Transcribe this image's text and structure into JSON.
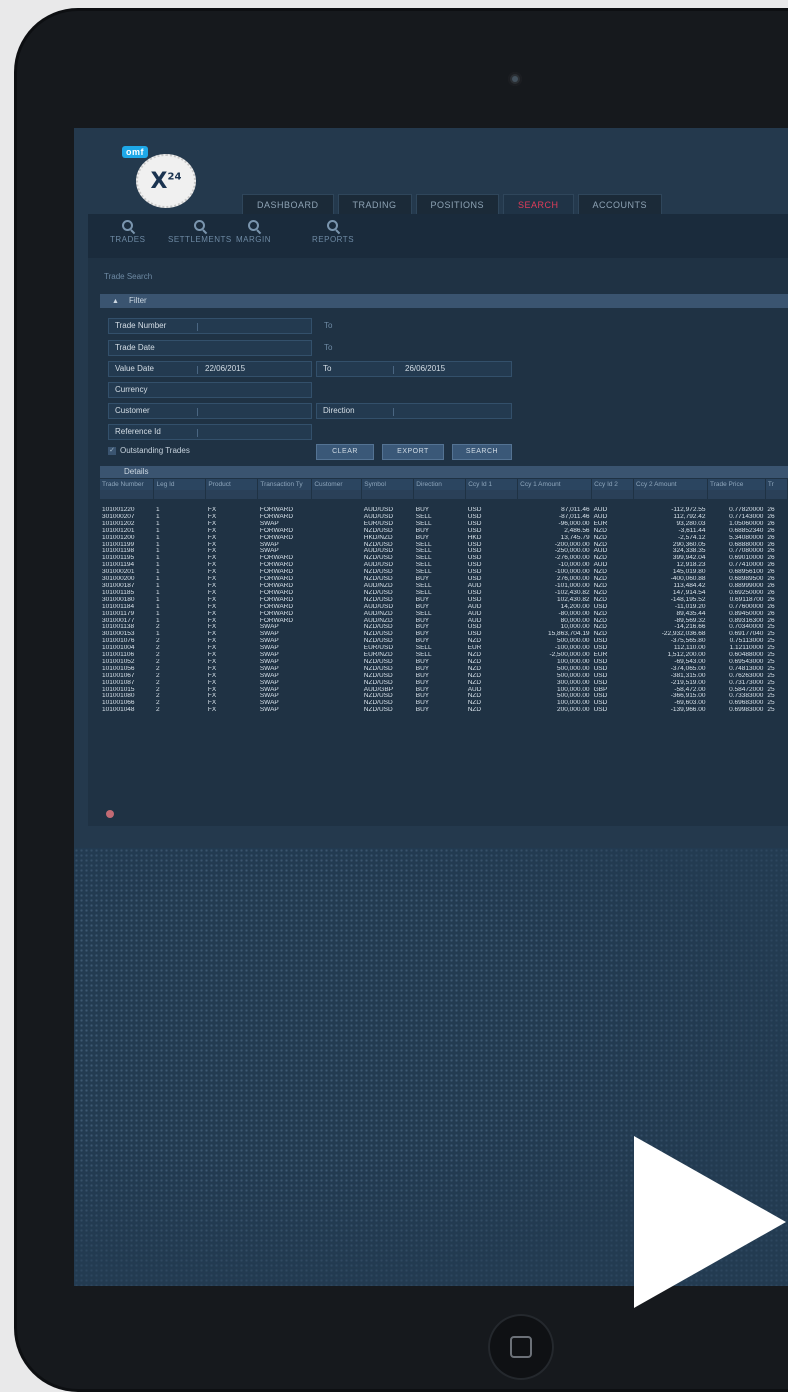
{
  "logo": {
    "tag": "omf",
    "mark": "X",
    "mark_sup": "24"
  },
  "tabs": [
    "DASHBOARD",
    "TRADING",
    "POSITIONS",
    "SEARCH",
    "ACCOUNTS"
  ],
  "active_tab": "SEARCH",
  "subnav": [
    "TRADES",
    "SETTLEMENTS",
    "MARGIN",
    "REPORTS"
  ],
  "section_title": "Trade Search",
  "filter": {
    "label": "Filter",
    "trade_number": "Trade Number",
    "trade_date": "Trade Date",
    "value_date": "Value Date",
    "value_date_from": "22/06/2015",
    "to": "To",
    "value_date_to": "26/06/2015",
    "currency": "Currency",
    "customer": "Customer",
    "direction": "Direction",
    "reference_id": "Reference Id",
    "outstanding": "Outstanding Trades",
    "buttons": {
      "clear": "CLEAR",
      "export": "EXPORT",
      "search": "SEARCH"
    }
  },
  "details": {
    "label": "Details",
    "columns": [
      "Trade Number",
      "Leg Id",
      "Product",
      "Transaction Ty",
      "Customer",
      "Symbol",
      "Direction",
      "Ccy Id 1",
      "Ccy 1 Amount",
      "Ccy Id 2",
      "Ccy 2 Amount",
      "Trade Price",
      "Tr"
    ],
    "rows": [
      [
        "101001220",
        "1",
        "FX",
        "FORWARD",
        "",
        "AUD/USD",
        "BUY",
        "USD",
        "87,011.46",
        "AUD",
        "-112,972.55",
        "0.77820000",
        "26"
      ],
      [
        "301000207",
        "1",
        "FX",
        "FORWARD",
        "",
        "AUD/USD",
        "SELL",
        "USD",
        "-87,011.46",
        "AUD",
        "112,792.42",
        "0.77143000",
        "26"
      ],
      [
        "101001202",
        "1",
        "FX",
        "SWAP",
        "",
        "EUR/USD",
        "SELL",
        "USD",
        "-96,000.00",
        "EUR",
        "93,280.03",
        "1.05060000",
        "26"
      ],
      [
        "101001201",
        "1",
        "FX",
        "FORWARD",
        "",
        "NZD/USD",
        "BUY",
        "USD",
        "2,486.56",
        "NZD",
        "-3,611.44",
        "0.68852340",
        "26"
      ],
      [
        "101001200",
        "1",
        "FX",
        "FORWARD",
        "",
        "HKD/NZD",
        "BUY",
        "HKD",
        "13,745.79",
        "NZD",
        "-2,574.12",
        "5.34080000",
        "26"
      ],
      [
        "101001199",
        "1",
        "FX",
        "SWAP",
        "",
        "NZD/USD",
        "SELL",
        "USD",
        "-200,000.00",
        "NZD",
        "290,360.05",
        "0.68880000",
        "26"
      ],
      [
        "101001198",
        "1",
        "FX",
        "SWAP",
        "",
        "AUD/USD",
        "SELL",
        "USD",
        "-250,000.00",
        "AUD",
        "324,338.35",
        "0.77080000",
        "26"
      ],
      [
        "101001195",
        "1",
        "FX",
        "FORWARD",
        "",
        "NZD/USD",
        "SELL",
        "USD",
        "-276,000.00",
        "NZD",
        "399,942.04",
        "0.69010000",
        "26"
      ],
      [
        "101001194",
        "1",
        "FX",
        "FORWARD",
        "",
        "AUD/USD",
        "SELL",
        "USD",
        "-10,000.00",
        "AUD",
        "12,918.23",
        "0.77410000",
        "26"
      ],
      [
        "301000201",
        "1",
        "FX",
        "FORWARD",
        "",
        "NZD/USD",
        "SELL",
        "USD",
        "-100,000.00",
        "NZD",
        "145,019.80",
        "0.68956100",
        "26"
      ],
      [
        "301000200",
        "1",
        "FX",
        "FORWARD",
        "",
        "NZD/USD",
        "BUY",
        "USD",
        "276,000.00",
        "NZD",
        "-400,060.88",
        "0.68989500",
        "26"
      ],
      [
        "301000187",
        "1",
        "FX",
        "FORWARD",
        "",
        "AUD/NZD",
        "SELL",
        "AUD",
        "-101,000.00",
        "NZD",
        "113,484.42",
        "0.88999000",
        "26"
      ],
      [
        "101001185",
        "1",
        "FX",
        "FORWARD",
        "",
        "NZD/USD",
        "SELL",
        "USD",
        "-102,430.82",
        "NZD",
        "147,914.54",
        "0.69250000",
        "26"
      ],
      [
        "301000180",
        "1",
        "FX",
        "FORWARD",
        "",
        "NZD/USD",
        "BUY",
        "USD",
        "102,430.82",
        "NZD",
        "-148,195.52",
        "0.69118700",
        "26"
      ],
      [
        "101001184",
        "1",
        "FX",
        "FORWARD",
        "",
        "AUD/USD",
        "BUY",
        "AUD",
        "14,200.00",
        "USD",
        "-11,019.20",
        "0.77600000",
        "26"
      ],
      [
        "101001179",
        "1",
        "FX",
        "FORWARD",
        "",
        "AUD/NZD",
        "SELL",
        "AUD",
        "-80,000.00",
        "NZD",
        "89,435.44",
        "0.89450000",
        "26"
      ],
      [
        "301000177",
        "1",
        "FX",
        "FORWARD",
        "",
        "AUD/NZD",
        "BUY",
        "AUD",
        "80,000.00",
        "NZD",
        "-89,569.32",
        "0.89316300",
        "26"
      ],
      [
        "101001138",
        "2",
        "FX",
        "SWAP",
        "",
        "NZD/USD",
        "BUY",
        "USD",
        "10,000.00",
        "NZD",
        "-14,216.66",
        "0.70340000",
        "25"
      ],
      [
        "301000153",
        "1",
        "FX",
        "SWAP",
        "",
        "NZD/USD",
        "BUY",
        "USD",
        "15,863,704.19",
        "NZD",
        "-22,932,036.68",
        "0.69177040",
        "25"
      ],
      [
        "101001076",
        "2",
        "FX",
        "SWAP",
        "",
        "NZD/USD",
        "BUY",
        "NZD",
        "500,000.00",
        "USD",
        "-375,565.80",
        "0.75113000",
        "25"
      ],
      [
        "101001004",
        "2",
        "FX",
        "SWAP",
        "",
        "EUR/USD",
        "SELL",
        "EUR",
        "-100,000.00",
        "USD",
        "112,110.00",
        "1.12110000",
        "25"
      ],
      [
        "101001106",
        "2",
        "FX",
        "SWAP",
        "",
        "EUR/NZD",
        "SELL",
        "NZD",
        "-2,500,000.00",
        "EUR",
        "1,512,200.00",
        "0.60488000",
        "25"
      ],
      [
        "101001052",
        "2",
        "FX",
        "SWAP",
        "",
        "NZD/USD",
        "BUY",
        "NZD",
        "100,000.00",
        "USD",
        "-69,543.00",
        "0.69543000",
        "25"
      ],
      [
        "101001056",
        "2",
        "FX",
        "SWAP",
        "",
        "NZD/USD",
        "BUY",
        "NZD",
        "500,000.00",
        "USD",
        "-374,065.00",
        "0.74813000",
        "25"
      ],
      [
        "101001067",
        "2",
        "FX",
        "SWAP",
        "",
        "NZD/USD",
        "BUY",
        "NZD",
        "500,000.00",
        "USD",
        "-381,315.00",
        "0.76263000",
        "25"
      ],
      [
        "101001087",
        "2",
        "FX",
        "SWAP",
        "",
        "NZD/USD",
        "BUY",
        "NZD",
        "300,000.00",
        "USD",
        "-219,519.00",
        "0.73173000",
        "25"
      ],
      [
        "101001015",
        "2",
        "FX",
        "SWAP",
        "",
        "AUD/GBP",
        "BUY",
        "AUD",
        "100,000.00",
        "GBP",
        "-58,472.00",
        "0.58472000",
        "25"
      ],
      [
        "101001080",
        "2",
        "FX",
        "SWAP",
        "",
        "NZD/USD",
        "BUY",
        "NZD",
        "500,000.00",
        "USD",
        "-366,915.00",
        "0.73383000",
        "25"
      ],
      [
        "101001066",
        "2",
        "FX",
        "SWAP",
        "",
        "NZD/USD",
        "BUY",
        "NZD",
        "100,000.00",
        "USD",
        "-69,603.00",
        "0.69683000",
        "25"
      ],
      [
        "101001048",
        "2",
        "FX",
        "SWAP",
        "",
        "NZD/USD",
        "BUY",
        "NZD",
        "200,000.00",
        "USD",
        "-139,966.00",
        "0.69983000",
        "25"
      ]
    ]
  }
}
